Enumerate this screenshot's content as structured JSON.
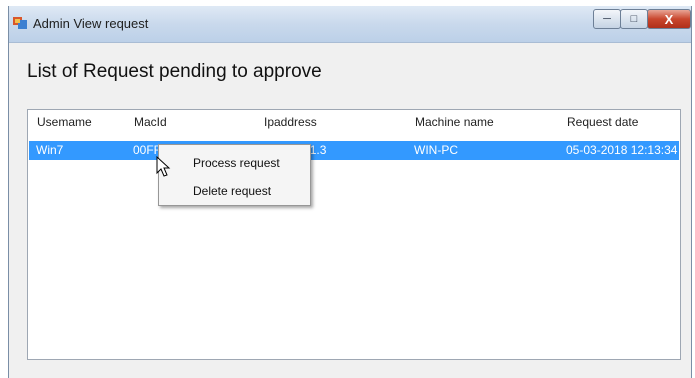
{
  "window": {
    "title": "Admin View request"
  },
  "controls": {
    "minimize": "─",
    "maximize": "□",
    "close": "X"
  },
  "heading": "List of Request pending to approve",
  "listview": {
    "columns": [
      "Usemame",
      "MacId",
      "Ipaddress",
      "Machine name",
      "Request date"
    ],
    "rows": [
      {
        "username": "Win7",
        "macid": "00FF8A3682FF",
        "ipaddress": "192.168.1.3",
        "machine": "WIN-PC",
        "date": "05-03-2018 12:13:34"
      }
    ]
  },
  "context_menu": {
    "items": [
      "Process request",
      "Delete request"
    ]
  },
  "colors": {
    "selection": "#3399ff",
    "titlebar": "#c9d9ec",
    "close_button": "#c9472e"
  }
}
